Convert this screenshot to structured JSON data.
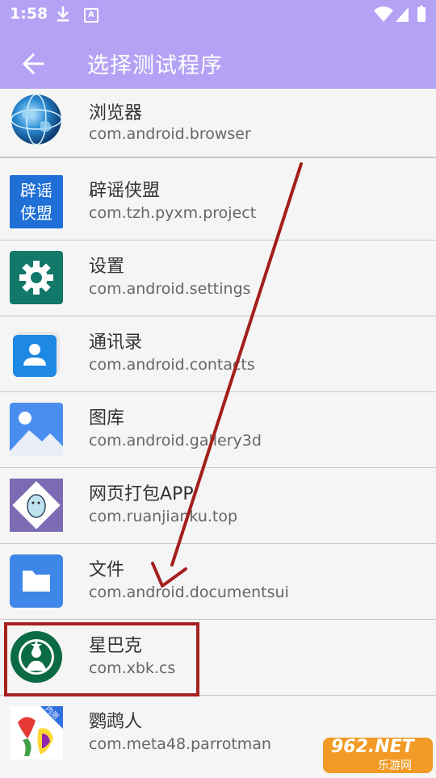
{
  "status": {
    "time": "1:58"
  },
  "appbar": {
    "title": "选择测试程序",
    "back_icon": "arrow-back-icon"
  },
  "apps": [
    {
      "name": "浏览器",
      "package": "com.android.browser",
      "icon": "globe-icon"
    },
    {
      "name": "辟谣侠盟",
      "package": "com.tzh.pyxm.project",
      "icon": "piyao-logo-icon",
      "icon_text": [
        "辟谣",
        "侠盟"
      ]
    },
    {
      "name": "设置",
      "package": "com.android.settings",
      "icon": "gear-icon"
    },
    {
      "name": "通讯录",
      "package": "com.android.contacts",
      "icon": "contacts-icon"
    },
    {
      "name": "图库",
      "package": "com.android.gallery3d",
      "icon": "gallery-icon"
    },
    {
      "name": "网页打包APP",
      "package": "com.ruanjianku.top",
      "icon": "moomin-icon"
    },
    {
      "name": "文件",
      "package": "com.android.documentsui",
      "icon": "folder-icon"
    },
    {
      "name": "星巴克",
      "package": "com.xbk.cs",
      "icon": "starbucks-logo-icon"
    },
    {
      "name": "鹦鹉人",
      "package": "com.meta48.parrotman",
      "icon": "parrotman-icon",
      "badge": "内测"
    }
  ],
  "colors": {
    "appbar": "#b4a3f5",
    "highlight": "#a62220",
    "arrow": "#a31f1c"
  },
  "watermark": {
    "text": "962.NET",
    "subtext": "乐游网"
  }
}
